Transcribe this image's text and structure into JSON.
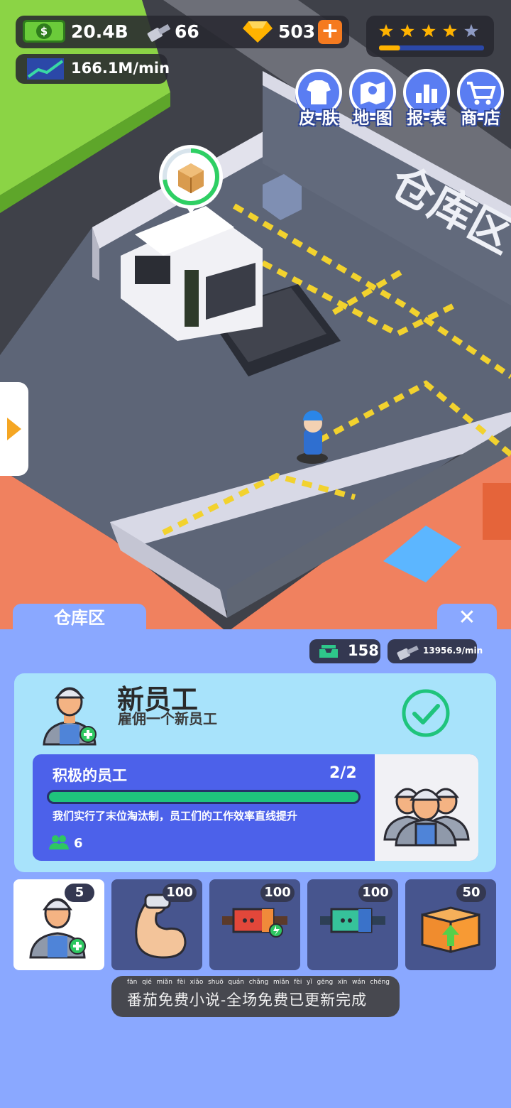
{
  "hud": {
    "cash": "20.4B",
    "bolts": "66",
    "gems": "503",
    "plus": "+",
    "income_rate": "166.1M/min",
    "stars_filled": 4,
    "stars_total": 5,
    "star_progress": 0.2
  },
  "menu": [
    {
      "label": "皮-肤",
      "icon": "shirt-icon"
    },
    {
      "label": "地-图",
      "icon": "map-icon"
    },
    {
      "label": "报-表",
      "icon": "chart-icon"
    },
    {
      "label": "商-店",
      "icon": "cart-icon"
    }
  ],
  "scene": {
    "zone_floor_text": "仓库区"
  },
  "panel": {
    "tab_title": "仓库区",
    "close": "✕",
    "stat_capacity": "158",
    "stat_rate": "13956.9/min",
    "card": {
      "title": "新员工",
      "subtitle": "雇佣一个新员工",
      "task": {
        "title": "积极的员工",
        "count": "2/2",
        "progress": 1.0,
        "description": "我们实行了末位淘汰制，员工们的工作效率直线提升",
        "workers": "6"
      }
    },
    "items": [
      {
        "badge": "5",
        "icon": "worker-add-icon"
      },
      {
        "badge": "100",
        "icon": "muscle-arm-icon"
      },
      {
        "badge": "100",
        "icon": "red-conveyor-icon"
      },
      {
        "badge": "100",
        "icon": "green-conveyor-icon"
      },
      {
        "badge": "50",
        "icon": "box-upgrade-icon"
      }
    ],
    "banner": {
      "pinyin": [
        "fān",
        "qié",
        "miǎn",
        "fèi",
        "xiǎo",
        "shuō",
        "quán",
        "chǎng",
        "miǎn",
        "fèi",
        "yǐ",
        "gēng",
        "xīn",
        "wán",
        "chéng"
      ],
      "text": "番茄免费小说-全场免费已更新完成"
    }
  },
  "colors": {
    "panel_bg": "#8aa8ff",
    "card_bg": "#a8e3fb",
    "task_bg": "#4c61ea",
    "progress_green": "#1fc47c",
    "accent_orange": "#f57a1f"
  }
}
